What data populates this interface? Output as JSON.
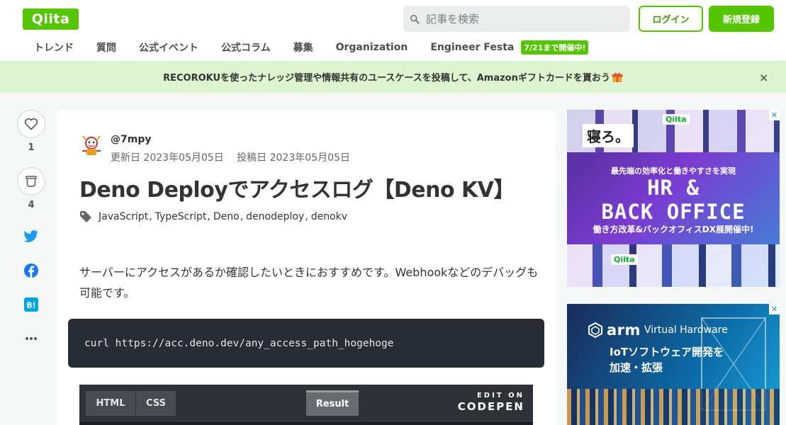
{
  "header": {
    "logo": "Qiita",
    "search_placeholder": "記事を検索",
    "login_label": "ログイン",
    "signup_label": "新規登録"
  },
  "nav": {
    "items": [
      "トレンド",
      "質問",
      "公式イベント",
      "公式コラム",
      "募集",
      "Organization",
      "Engineer Festa"
    ],
    "badge": "7/21まで開催中!"
  },
  "banner": {
    "text": "RECOROKUを使ったナレッジ管理や情報共有のユースケースを投稿して、Amazonギフトカードを貰おう",
    "close_label": "×"
  },
  "actions": {
    "like_count": "1",
    "stock_count": "4"
  },
  "article": {
    "author": "@7mpy",
    "updated": "更新日 2023年05月05日",
    "posted": "投稿日 2023年05月05日",
    "title": "Deno Deployでアクセスログ【Deno KV】",
    "tags": [
      "JavaScript",
      "TypeScript",
      "Deno",
      "denodeploy",
      "denokv"
    ],
    "body": "サーバーにアクセスがあるか確認したいときにおすすめです。Webhookなどのデバッグも可能です。",
    "code": "curl https://acc.deno.dev/any_access_path_hogehoge"
  },
  "codepen": {
    "tab_html": "HTML",
    "tab_css": "CSS",
    "tab_result": "Result",
    "edit_on": "EDIT ON",
    "brand": "CODEPEN"
  },
  "ads": {
    "ad1": {
      "brand": "Qiita",
      "tag": "寝ろ。",
      "sub": "最先端の効率化と働きやすさを実現",
      "main_line1": "HR &",
      "main_line2": "BACK OFFICE",
      "foot": "働き方改革&バックオフィスDX展開催中!"
    },
    "ad2": {
      "brand_prefix": "arm",
      "brand_suffix": "Virtual Hardware",
      "title_line1": "IoTソフトウェア開発を",
      "title_line2": "加速・拡張"
    }
  },
  "colors": {
    "brand": "#55c500",
    "banner_bg": "#dcf5d0",
    "code_bg": "#282c34"
  }
}
